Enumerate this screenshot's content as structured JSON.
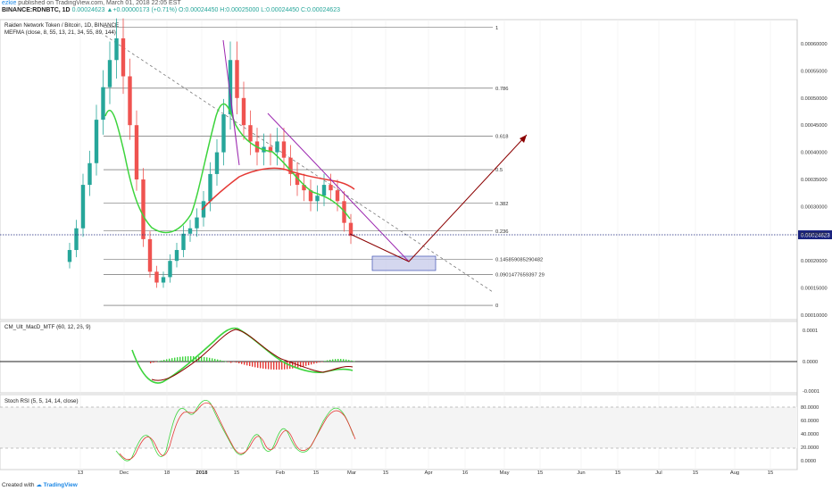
{
  "header": {
    "author": "ezkie",
    "published_text": "published on TradingView.com, March 01, 2018 22:05 EST",
    "symbol_line": "BINANCE:RDNBTC, 1D",
    "ohlc_line": "0.00024623 ▲+0.00000173 (+0.71%) O:0.00024450 H:0.00025000 L:0.00024450 C:0.00024623"
  },
  "legend": {
    "title": "Raiden Network Token / Bitcoin, 1D, BINANCE",
    "indicator": "MEFMA (close, 8, 55, 13, 21, 34, 55, 89, 144)",
    "macd": "CM_Ult_MacD_MTF (60, 12, 26, 9)",
    "rsi": "Stoch RSI (5, 5, 14, 14, close)"
  },
  "footer": {
    "created_with": "Created with",
    "brand": "TradingView"
  },
  "colors": {
    "up": "#26a69a",
    "down": "#ef5350",
    "green": "#3dd43d",
    "red_ma": "#e53935",
    "purple": "#9c27b0",
    "arrow": "#8b0000",
    "price_line": "#1a237e",
    "box": "#7986cb"
  },
  "chart_data": [
    {
      "type": "candlestick",
      "title": "Raiden Network Token / Bitcoin, 1D, BINANCE",
      "x_ticks": [
        "13",
        "Dec",
        "18",
        "2018",
        "15",
        "Feb",
        "15",
        "Mar",
        "15",
        "Apr",
        "16",
        "May",
        "15",
        "Jun",
        "15",
        "Jul",
        "15",
        "Aug",
        "15"
      ],
      "y_ticks": [
        "0.00060000",
        "0.00055000",
        "0.00050000",
        "0.00045000",
        "0.00040000",
        "0.00035000",
        "0.00030000",
        "0.00025000",
        "0.00020000",
        "0.00015000",
        "0.00010000"
      ],
      "ylim": [
        0.0001,
        0.00064
      ],
      "last_price": "0.00024623",
      "fib_levels": [
        {
          "label": "1",
          "value": 0.00063
        },
        {
          "label": "0.786",
          "value": 0.000518
        },
        {
          "label": "0.618",
          "value": 0.00043
        },
        {
          "label": "0.5",
          "value": 0.000368
        },
        {
          "label": "0.382",
          "value": 0.000306
        },
        {
          "label": "0.236",
          "value": 0.000255
        },
        {
          "label": "0.145859085290482",
          "value": 0.000203
        },
        {
          "label": "0.0901477659397 29",
          "value": 0.000175
        },
        {
          "label": "0",
          "value": 0.000118
        }
      ],
      "close_series": [
        0.00022,
        0.00026,
        0.00034,
        0.00038,
        0.00046,
        0.00052,
        0.00057,
        0.00061,
        0.00054,
        0.00045,
        0.00035,
        0.00024,
        0.00018,
        0.00016,
        0.00017,
        0.0002,
        0.00022,
        0.00025,
        0.00026,
        0.00028,
        0.00031,
        0.00036,
        0.0004,
        0.00047,
        0.00057,
        0.0005,
        0.00045,
        0.00042,
        0.0004,
        0.00041,
        0.0004,
        0.00042,
        0.00039,
        0.00036,
        0.00034,
        0.00033,
        0.00031,
        0.00032,
        0.00034,
        0.00033,
        0.00031,
        0.00027,
        0.000246
      ]
    },
    {
      "type": "line",
      "title": "CM_Ult_MacD_MTF (60, 12, 26, 9)",
      "y_ticks": [
        "0.0001",
        "0.0000",
        "-0.0001"
      ]
    },
    {
      "type": "line",
      "title": "Stoch RSI (5, 5, 14, 14, close)",
      "y_ticks": [
        "80.0000",
        "60.0000",
        "40.0000",
        "20.0000",
        "0.0000"
      ]
    }
  ]
}
